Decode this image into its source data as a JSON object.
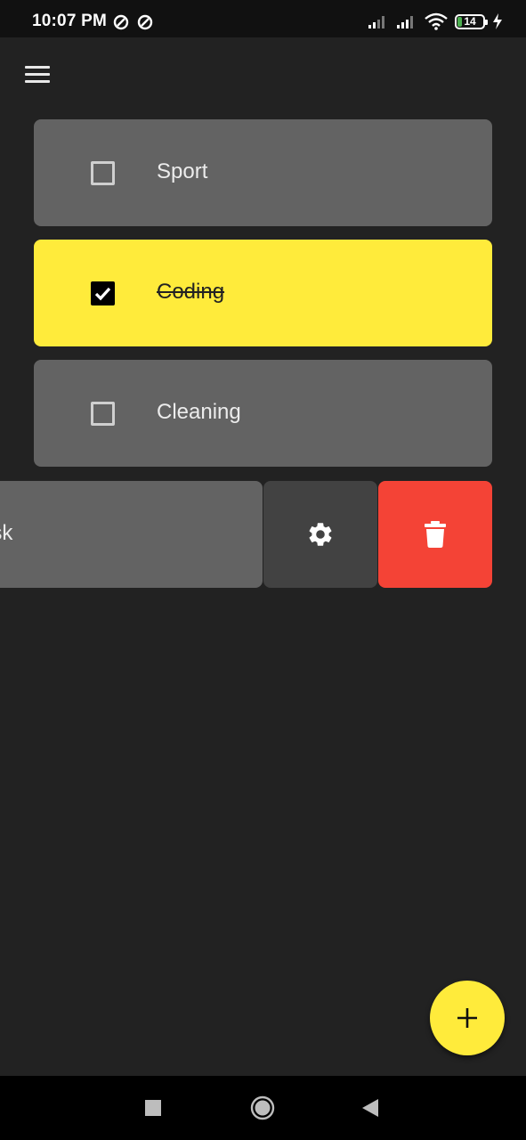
{
  "status_bar": {
    "time": "10:07 PM",
    "battery_level": "14",
    "icons": [
      "data-saver-icon",
      "data-saver-icon",
      "signal-icon",
      "signal-icon",
      "wifi-icon",
      "battery-icon",
      "charging-icon"
    ]
  },
  "app": {
    "menu_icon": "hamburger-menu-icon"
  },
  "tasks": [
    {
      "label": "Sport",
      "done": false
    },
    {
      "label": "Coding",
      "done": true
    },
    {
      "label": "Cleaning",
      "done": false
    }
  ],
  "swiped_task": {
    "label_fragment": "ask",
    "actions": [
      {
        "icon": "gear-icon",
        "color": "#424242"
      },
      {
        "icon": "trash-icon",
        "color": "#f44336"
      }
    ]
  },
  "fab": {
    "icon": "plus-icon",
    "color": "#ffeb3b"
  },
  "nav_bar": {
    "buttons": [
      "recents-square-icon",
      "home-circle-icon",
      "back-triangle-icon"
    ]
  },
  "colors": {
    "background": "#222222",
    "card": "#636363",
    "accent": "#ffeb3b",
    "danger": "#f44336"
  }
}
